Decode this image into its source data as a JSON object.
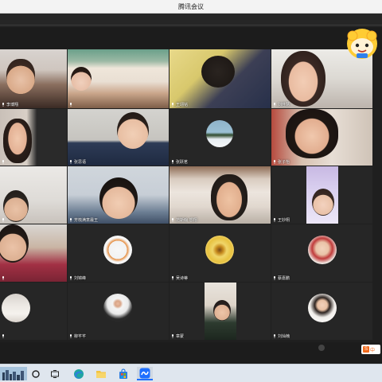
{
  "window": {
    "title": "腾讯会议"
  },
  "participants": [
    {
      "name": "李博翔"
    },
    {
      "name": ""
    },
    {
      "name": "王翊铭"
    },
    {
      "name": "刘佳慧"
    },
    {
      "name": ""
    },
    {
      "name": "张思语"
    },
    {
      "name": "张跃茗"
    },
    {
      "name": "张子怡"
    },
    {
      "name": ""
    },
    {
      "name": "芳梳满意最王"
    },
    {
      "name": "范斯翰 想翔"
    },
    {
      "name": "王妙栩"
    },
    {
      "name": ""
    },
    {
      "name": "刘锦峰"
    },
    {
      "name": "吴诗蒂"
    },
    {
      "name": "蔡嘉鹏"
    },
    {
      "name": ""
    },
    {
      "name": "柳芊芊"
    },
    {
      "name": "章蒙"
    },
    {
      "name": "刘灿楠"
    }
  ],
  "status": {
    "tray_text": "中"
  },
  "colors": {
    "background": "#1f1f1f",
    "tile": "#262626",
    "titlebar": "#f3f3f3",
    "taskbar": "#dfe6ee",
    "meeting_blue": "#1e6fff",
    "ime_orange": "#f26b1d"
  },
  "taskbar": {
    "icons": [
      "skyline-thumbnail-icon",
      "search-circle-icon",
      "task-view-icon",
      "edge-browser-icon",
      "file-explorer-icon",
      "store-bag-icon",
      "tencent-meeting-icon"
    ]
  }
}
